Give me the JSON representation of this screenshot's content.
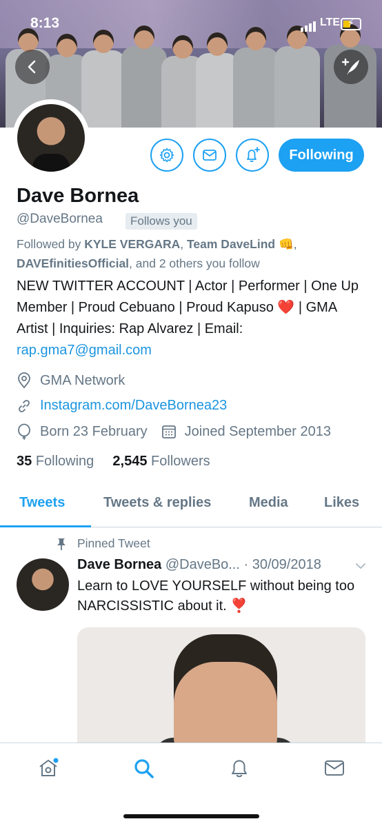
{
  "status_bar": {
    "time": "8:13",
    "network": "LTE"
  },
  "profile": {
    "name": "Dave Bornea",
    "handle": "@DaveBornea",
    "follows_you": "Follows you",
    "following_button": "Following",
    "followed_by": {
      "prefix": "Followed by ",
      "name1": "KYLE VERGARA",
      "sep1": ", ",
      "name2": "Team DaveLind 👊",
      "sep2": ",",
      "name3": "DAVEfinitiesOfficial",
      "suffix": ", and 2 others you follow"
    },
    "bio": "NEW TWITTER ACCOUNT | Actor | Performer | One Up Member | Proud Cebuano | Proud Kapuso ❤️ | GMA Artist | Inquiries: Rap Alvarez | Email: ",
    "bio_email": "rap.gma7@gmail.com",
    "location": "GMA Network",
    "website": "Instagram.com/DaveBornea23",
    "birthday": "Born 23 February",
    "joined": "Joined September 2013",
    "following_count": "35",
    "following_label": "Following",
    "followers_count": "2,545",
    "followers_label": "Followers"
  },
  "tabs": [
    "Tweets",
    "Tweets & replies",
    "Media",
    "Likes"
  ],
  "pinned_tweet": {
    "pinned_label": "Pinned Tweet",
    "author": "Dave Bornea",
    "handle": "@DaveBo...",
    "date": "· 30/09/2018",
    "text": "Learn to LOVE YOURSELF without being too NARCISSISTIC about it. ❣️"
  },
  "colors": {
    "accent": "#1da1f2",
    "link": "#1b95e0",
    "secondary_text": "#657786"
  }
}
